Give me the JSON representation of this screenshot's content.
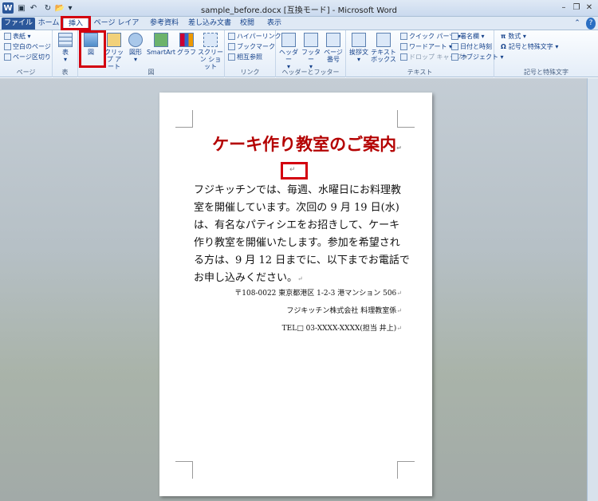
{
  "window": {
    "title": "sample_before.docx [互換モード] - Microsoft Word",
    "min": "–",
    "restore": "❐",
    "close": "✕"
  },
  "qat": {
    "undo": "↶",
    "redo": "↻",
    "open": "📂",
    "more": "▾"
  },
  "tabs": [
    "ファイル",
    "ホーム",
    "挿入",
    "ページ レイアウト",
    "参考資料",
    "差し込み文書",
    "校閲",
    "表示"
  ],
  "ribbon": {
    "page": {
      "label": "ページ",
      "cover": "表紙 ▾",
      "blank": "空白のページ",
      "break": "ページ区切り"
    },
    "table": {
      "label": "表",
      "btn": "表"
    },
    "illus": {
      "label": "図",
      "picture": "図",
      "clipart": "クリップ アート",
      "shapes": "図形",
      "smartart": "SmartArt",
      "chart": "グラフ",
      "screenshot": "スクリーン ショット"
    },
    "links": {
      "label": "リンク",
      "hyperlink": "ハイパーリンク",
      "bookmark": "ブックマーク",
      "crossref": "相互参照"
    },
    "hf": {
      "label": "ヘッダーとフッター",
      "header": "ヘッダー",
      "footer": "フッター",
      "pagenum": "ページ 番号"
    },
    "text": {
      "label": "テキスト",
      "greeting": "挨拶文",
      "textbox": "テキスト ボックス",
      "quickparts": "クイック パーツ ▾",
      "wordart": "ワードアート ▾",
      "dropcap": "ドロップ キャップ ▾",
      "signature": "署名欄 ▾",
      "datetime": "日付と時刻",
      "object": "オブジェクト ▾"
    },
    "symbols": {
      "label": "記号と特殊文字",
      "equation": "数式 ▾",
      "symbol": "記号と特殊文字 ▾"
    }
  },
  "doc": {
    "title": "ケーキ作り教室のご案内",
    "lines": [
      "フジキッチンでは、毎週、水曜日にお料理教",
      "室を開催しています。次回の 9 月 19 日(水)",
      "は、有名なパティシエをお招きして、ケーキ",
      "作り教室を開催いたします。参加を希望され",
      "る方は、9 月 12 日までに、以下までお電話で",
      "お申し込みください。"
    ],
    "address": "〒108-0022 東京都港区 1-2-3 港マンション 506",
    "company": "フジキッチン株式会社 料理教室係",
    "tel": "TEL□ 03-XXXX-XXXX(担当 井上)",
    "para": "↵"
  },
  "colors": {
    "accent": "#2b579a",
    "highlight": "#d3000f",
    "title": "#b40000"
  }
}
